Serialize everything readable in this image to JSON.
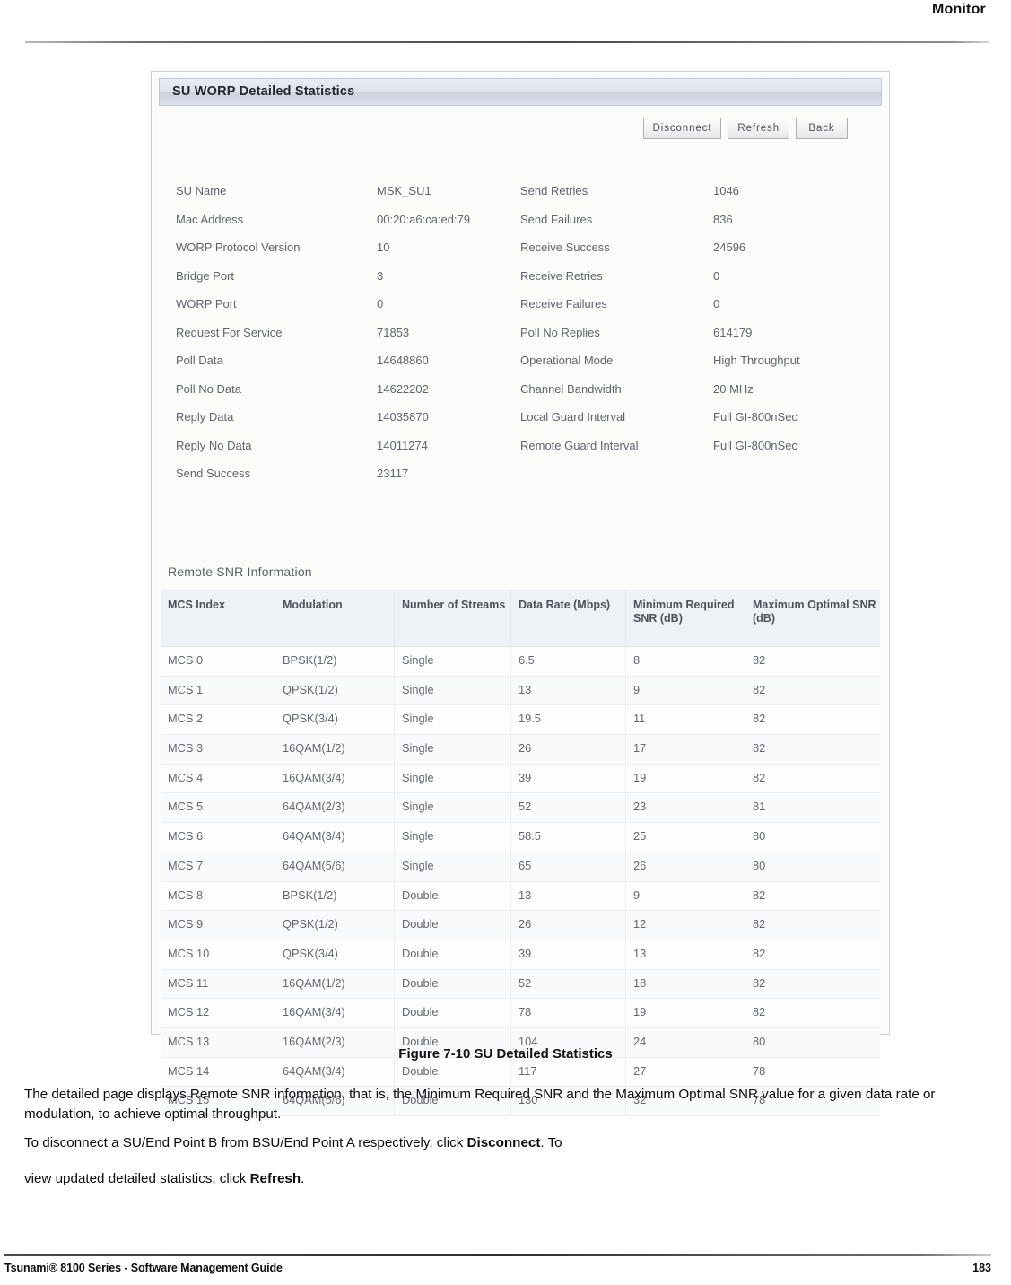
{
  "header": {
    "title": "Monitor"
  },
  "panel": {
    "title": "SU WORP Detailed Statistics",
    "buttons": [
      {
        "label": "Disconnect",
        "name": "disconnect-button"
      },
      {
        "label": "Refresh",
        "name": "refresh-button"
      },
      {
        "label": "Back",
        "name": "back-button"
      }
    ]
  },
  "statistics": [
    {
      "left_key": "SU Name",
      "left_value": "MSK_SU1",
      "right_key": "Send Retries",
      "right_value": "1046"
    },
    {
      "left_key": "Mac Address",
      "left_value": "00:20:a6:ca:ed:79",
      "right_key": "Send Failures",
      "right_value": "836"
    },
    {
      "left_key": "WORP Protocol Version",
      "left_value": "10",
      "right_key": "Receive Success",
      "right_value": "24596"
    },
    {
      "left_key": "Bridge Port",
      "left_value": "3",
      "right_key": "Receive Retries",
      "right_value": "0"
    },
    {
      "left_key": "WORP Port",
      "left_value": "0",
      "right_key": "Receive Failures",
      "right_value": "0"
    },
    {
      "left_key": "Request For Service",
      "left_value": "71853",
      "right_key": "Poll No Replies",
      "right_value": "614179"
    },
    {
      "left_key": "Poll Data",
      "left_value": "14648860",
      "right_key": "Operational Mode",
      "right_value": "High Throughput"
    },
    {
      "left_key": "Poll No Data",
      "left_value": "14622202",
      "right_key": "Channel Bandwidth",
      "right_value": "20  MHz"
    },
    {
      "left_key": "Reply Data",
      "left_value": "14035870",
      "right_key": "Local Guard Interval",
      "right_value": "Full GI-800nSec"
    },
    {
      "left_key": "Reply No Data",
      "left_value": "14011274",
      "right_key": "Remote Guard Interval",
      "right_value": "Full GI-800nSec"
    },
    {
      "left_key": "Send Success",
      "left_value": "23117",
      "right_key": "",
      "right_value": ""
    }
  ],
  "snr": {
    "heading": "Remote SNR Information",
    "columns": [
      "MCS Index",
      "Modulation",
      "Number of Streams",
      "Data Rate (Mbps)",
      "Minimum Required SNR (dB)",
      "Maximum Optimal SNR (dB)"
    ],
    "rows": [
      [
        "MCS 0",
        "BPSK(1/2)",
        "Single",
        "6.5",
        "8",
        "82"
      ],
      [
        "MCS 1",
        "QPSK(1/2)",
        "Single",
        "13",
        "9",
        "82"
      ],
      [
        "MCS 2",
        "QPSK(3/4)",
        "Single",
        "19.5",
        "11",
        "82"
      ],
      [
        "MCS 3",
        "16QAM(1/2)",
        "Single",
        "26",
        "17",
        "82"
      ],
      [
        "MCS 4",
        "16QAM(3/4)",
        "Single",
        "39",
        "19",
        "82"
      ],
      [
        "MCS 5",
        "64QAM(2/3)",
        "Single",
        "52",
        "23",
        "81"
      ],
      [
        "MCS 6",
        "64QAM(3/4)",
        "Single",
        "58.5",
        "25",
        "80"
      ],
      [
        "MCS 7",
        "64QAM(5/6)",
        "Single",
        "65",
        "26",
        "80"
      ],
      [
        "MCS 8",
        "BPSK(1/2)",
        "Double",
        "13",
        "9",
        "82"
      ],
      [
        "MCS 9",
        "QPSK(1/2)",
        "Double",
        "26",
        "12",
        "82"
      ],
      [
        "MCS 10",
        "QPSK(3/4)",
        "Double",
        "39",
        "13",
        "82"
      ],
      [
        "MCS 11",
        "16QAM(1/2)",
        "Double",
        "52",
        "18",
        "82"
      ],
      [
        "MCS 12",
        "16QAM(3/4)",
        "Double",
        "78",
        "19",
        "82"
      ],
      [
        "MCS 13",
        "16QAM(2/3)",
        "Double",
        "104",
        "24",
        "80"
      ],
      [
        "MCS 14",
        "64QAM(3/4)",
        "Double",
        "117",
        "27",
        "78"
      ],
      [
        "MCS 15",
        "64QAM(5/6)",
        "Double",
        "130",
        "32",
        "78"
      ]
    ]
  },
  "caption": "Figure 7-10 SU Detailed Statistics",
  "body": {
    "para1": "The detailed page displays Remote SNR information, that is, the Minimum Required SNR and the Maximum Optimal SNR value for a given data rate or modulation, to achieve optimal throughput.",
    "para2_before": "To disconnect a SU/End Point B from BSU/End Point A respectively, click ",
    "para2_bold": "Disconnect",
    "para2_after": ". To",
    "para3_before": "view updated detailed statistics, click ",
    "para3_bold": "Refresh",
    "para3_after": "."
  },
  "footer": {
    "left": "Tsunami® 8100 Series - Software Management Guide",
    "page": "183"
  }
}
